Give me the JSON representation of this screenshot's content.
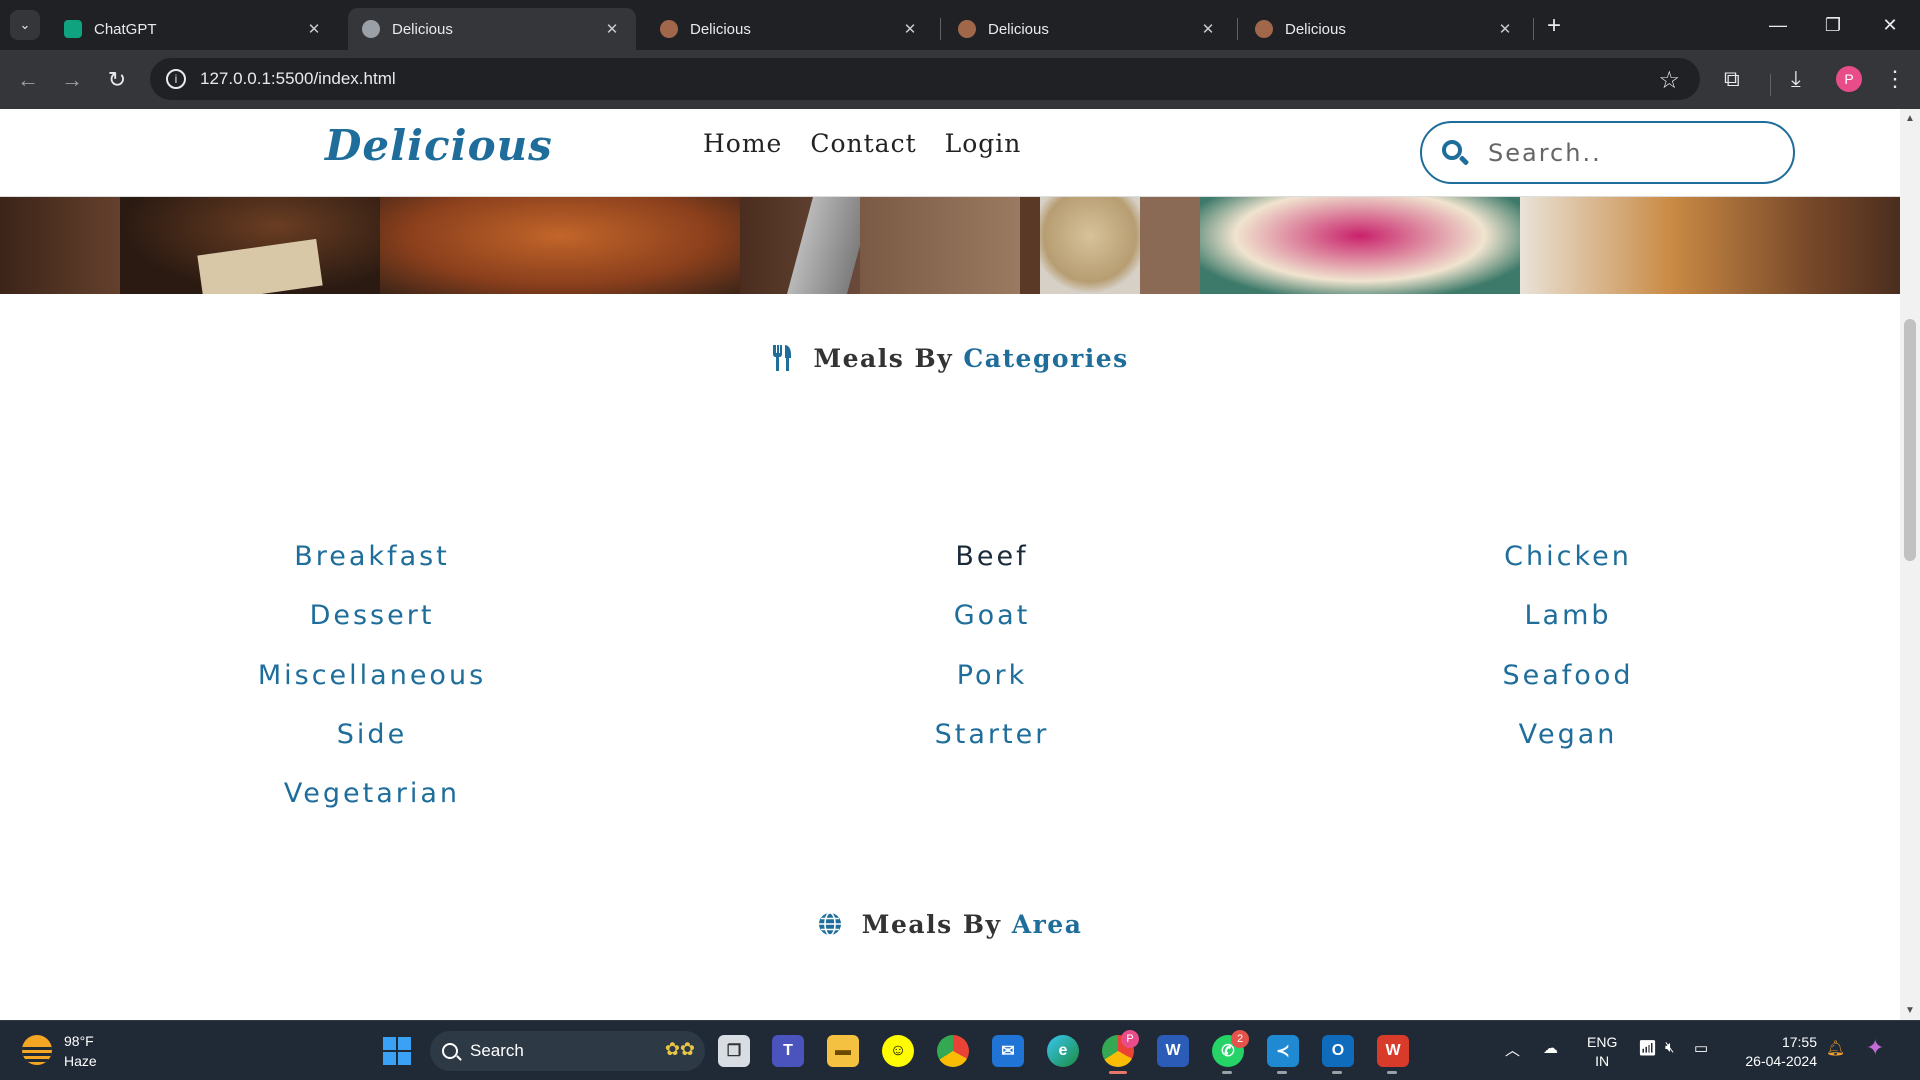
{
  "browser": {
    "tabs": [
      {
        "label": "ChatGPT",
        "favicon": "chatgpt-icon"
      },
      {
        "label": "Delicious",
        "favicon": "globe-icon"
      },
      {
        "label": "Delicious",
        "favicon": "food-favicon"
      },
      {
        "label": "Delicious",
        "favicon": "food-favicon"
      },
      {
        "label": "Delicious",
        "favicon": "food-favicon"
      }
    ],
    "active_tab_index": 1,
    "url": "127.0.0.1:5500/index.html",
    "profile_initial": "P"
  },
  "site": {
    "logo": "Delicious",
    "nav": [
      "Home",
      "Contact",
      "Login"
    ],
    "search_placeholder": "Search..",
    "accent_color": "#1e6d9a"
  },
  "categories_section": {
    "title_prefix": "Meals By",
    "title_accent": "Categories",
    "icon": "utensils-icon",
    "items": [
      "Breakfast",
      "Beef",
      "Chicken",
      "Dessert",
      "Goat",
      "Lamb",
      "Miscellaneous",
      "Pork",
      "Seafood",
      "Side",
      "Starter",
      "Vegan",
      "Vegetarian"
    ],
    "hovered_item": "Beef"
  },
  "area_section": {
    "title_prefix": "Meals By",
    "title_accent": "Area",
    "icon": "globe-icon"
  },
  "taskbar": {
    "weather_temp": "98°F",
    "weather_desc": "Haze",
    "search_label": "Search",
    "whatsapp_badge": "2",
    "chrome_badge": "P",
    "lang_line1": "ENG",
    "lang_line2": "IN",
    "time": "17:55",
    "date": "26-04-2024"
  }
}
